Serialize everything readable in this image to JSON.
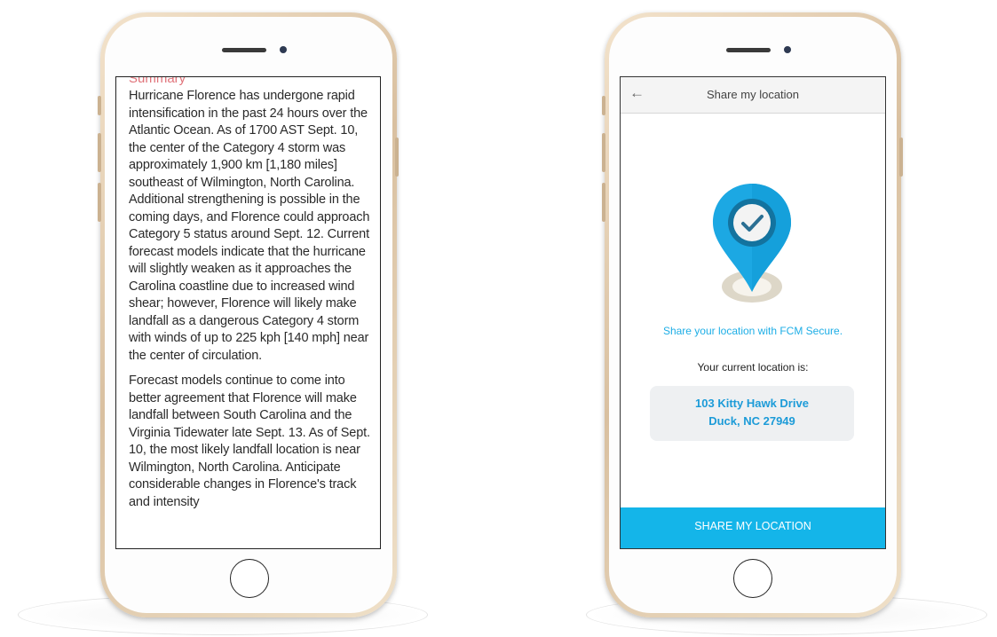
{
  "left_phone": {
    "section_title": "Summary",
    "paragraphs": [
      "Hurricane Florence has undergone rapid intensification in the past 24 hours over the Atlantic Ocean. As of 1700 AST Sept. 10, the center of the Category 4 storm was approximately 1,900 km [1,180 miles] southeast of Wilmington, North Carolina. Additional strengthening is possible in the coming days, and Florence could approach Category 5 status around Sept. 12. Current forecast models indicate that the hurricane will slightly weaken as it approaches the Carolina coastline due to increased wind shear; however, Florence will likely make landfall as a dangerous Category 4 storm with winds of up to 225 kph [140 mph] near the center of circulation.",
      "Forecast models continue to come into better agreement that Florence will make landfall between South Carolina and the Virginia Tidewater late Sept. 13. As of Sept. 10, the most likely landfall location is near Wilmington, North Carolina. Anticipate considerable changes in Florence's track and intensity"
    ]
  },
  "right_phone": {
    "header": {
      "back_icon": "back-arrow-icon",
      "title": "Share my location"
    },
    "pin_icon": "location-pin-check-icon",
    "share_prompt": "Share your location with FCM Secure.",
    "current_label": "Your current location is:",
    "address_line1": "103 Kitty Hawk Drive",
    "address_line2": "Duck, NC 27949",
    "share_button": "SHARE MY LOCATION"
  },
  "colors": {
    "accent_blue": "#14b5e9",
    "summary_red": "#e0737a",
    "phone_gold": "#d9c0a0"
  }
}
